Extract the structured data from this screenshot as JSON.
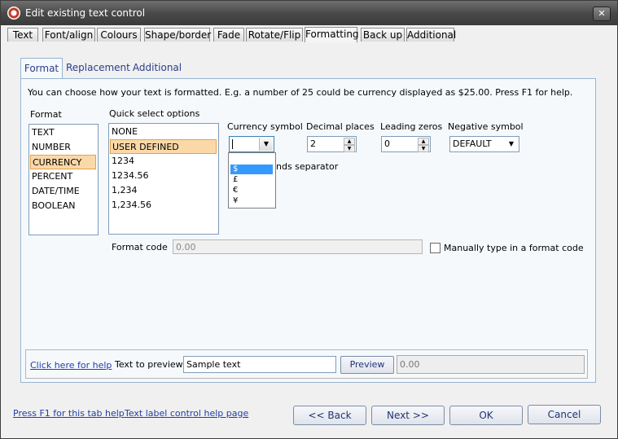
{
  "window": {
    "title": "Edit existing text control",
    "close": "✕"
  },
  "top_tabs": [
    {
      "label": "Text"
    },
    {
      "label": "Font/align"
    },
    {
      "label": "Colours"
    },
    {
      "label": "Shape/border"
    },
    {
      "label": "Fade"
    },
    {
      "label": "Rotate/Flip"
    },
    {
      "label": "Formatting"
    },
    {
      "label": "Back up"
    },
    {
      "label": "Additional"
    }
  ],
  "inner_tabs": [
    {
      "label": "Format"
    },
    {
      "label": "Replacement"
    },
    {
      "label": "Additional"
    }
  ],
  "description": "You can choose how your text is formatted.  E.g. a number of 25 could be currency displayed as $25.00.  Press F1 for help.",
  "format": {
    "label": "Format",
    "items": [
      "TEXT",
      "NUMBER",
      "CURRENCY",
      "PERCENT",
      "DATE/TIME",
      "BOOLEAN"
    ],
    "selected": "CURRENCY"
  },
  "quick_select": {
    "label": "Quick select options",
    "items": [
      "NONE",
      "USER DEFINED",
      "1234",
      "1234.56",
      "1,234",
      "1,234.56"
    ],
    "selected": "USER DEFINED"
  },
  "currency_symbol": {
    "label": "Currency symbol",
    "value": "",
    "options": [
      "$",
      "£",
      "€",
      "¥"
    ],
    "highlighted": "$"
  },
  "decimal_places": {
    "label": "Decimal places",
    "value": "2"
  },
  "leading_zeros": {
    "label": "Leading zeros",
    "value": "0"
  },
  "negative_symbol": {
    "label": "Negative symbol",
    "value": "DEFAULT"
  },
  "thousands_separator": {
    "label_visible_part": "nds separator"
  },
  "format_code": {
    "label": "Format code",
    "value": "0.00"
  },
  "manual_format": {
    "label": "Manually type in a format code",
    "checked": false
  },
  "preview": {
    "help_link": "Click here for help",
    "label": "Text to preview",
    "input_value": "Sample text",
    "button": "Preview",
    "result": "0.00"
  },
  "footer": {
    "link_f1": "Press F1 for this tab help",
    "link_help_page": "Text label control help page",
    "back": "<< Back",
    "next": "Next >>",
    "ok": "OK",
    "cancel": "Cancel"
  },
  "colors": {
    "accent": "#3399ff",
    "selection": "#fbd8a8",
    "link": "#1f3fa8"
  }
}
